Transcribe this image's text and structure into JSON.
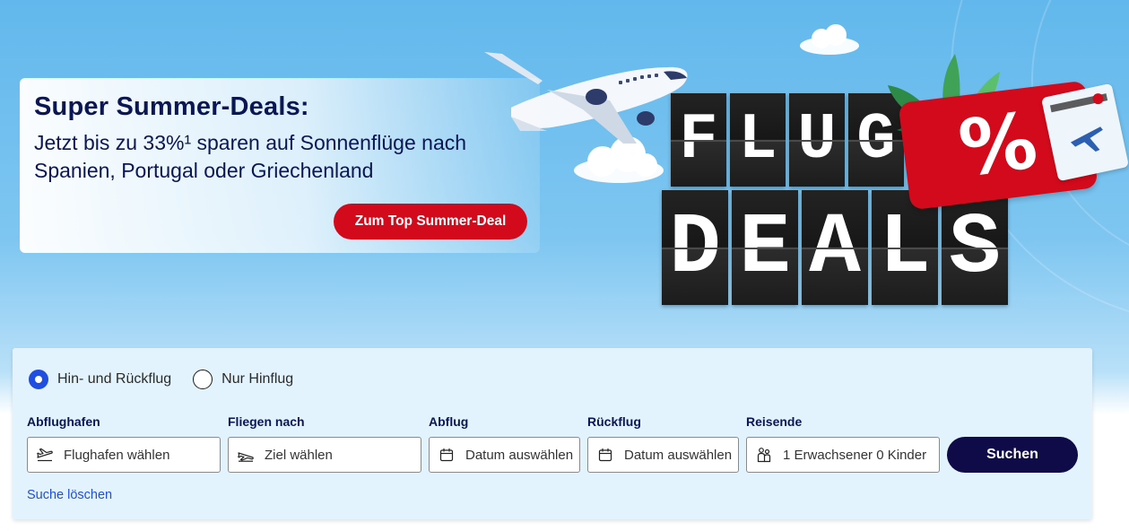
{
  "promo": {
    "title": "Super Summer-Deals:",
    "line1": "Jetzt bis zu 33%¹ sparen auf Sonnenflüge nach",
    "line2": "Spanien, Portugal oder Griechenland",
    "cta_label": "Zum Top Summer-Deal"
  },
  "board": {
    "row1": [
      "F",
      "L",
      "U",
      "G"
    ],
    "row2": [
      "D",
      "E",
      "A",
      "L",
      "S"
    ],
    "percent": "%"
  },
  "search": {
    "trip_types": [
      {
        "label": "Hin- und Rückflug",
        "selected": true
      },
      {
        "label": "Nur Hinflug",
        "selected": false
      }
    ],
    "fields": [
      {
        "label": "Abflughafen",
        "value": "Flughafen wählen",
        "icon": "departure-plane-icon"
      },
      {
        "label": "Fliegen nach",
        "value": "Ziel wählen",
        "icon": "destination-plane-icon"
      },
      {
        "label": "Abflug",
        "value": "Datum auswählen",
        "icon": "calendar-icon"
      },
      {
        "label": "Rückflug",
        "value": "Datum auswählen",
        "icon": "calendar-icon"
      },
      {
        "label": "Reisende",
        "value": "1 Erwachsener 0 Kinder",
        "icon": "travelers-icon"
      }
    ],
    "submit_label": "Suchen",
    "clear_label": "Suche löschen"
  },
  "colors": {
    "brand_navy": "#0b1655",
    "cta_red": "#d30a1b",
    "search_button": "#0f0b48",
    "link_blue": "#1f4ee0",
    "sky": "#62b8ec"
  }
}
